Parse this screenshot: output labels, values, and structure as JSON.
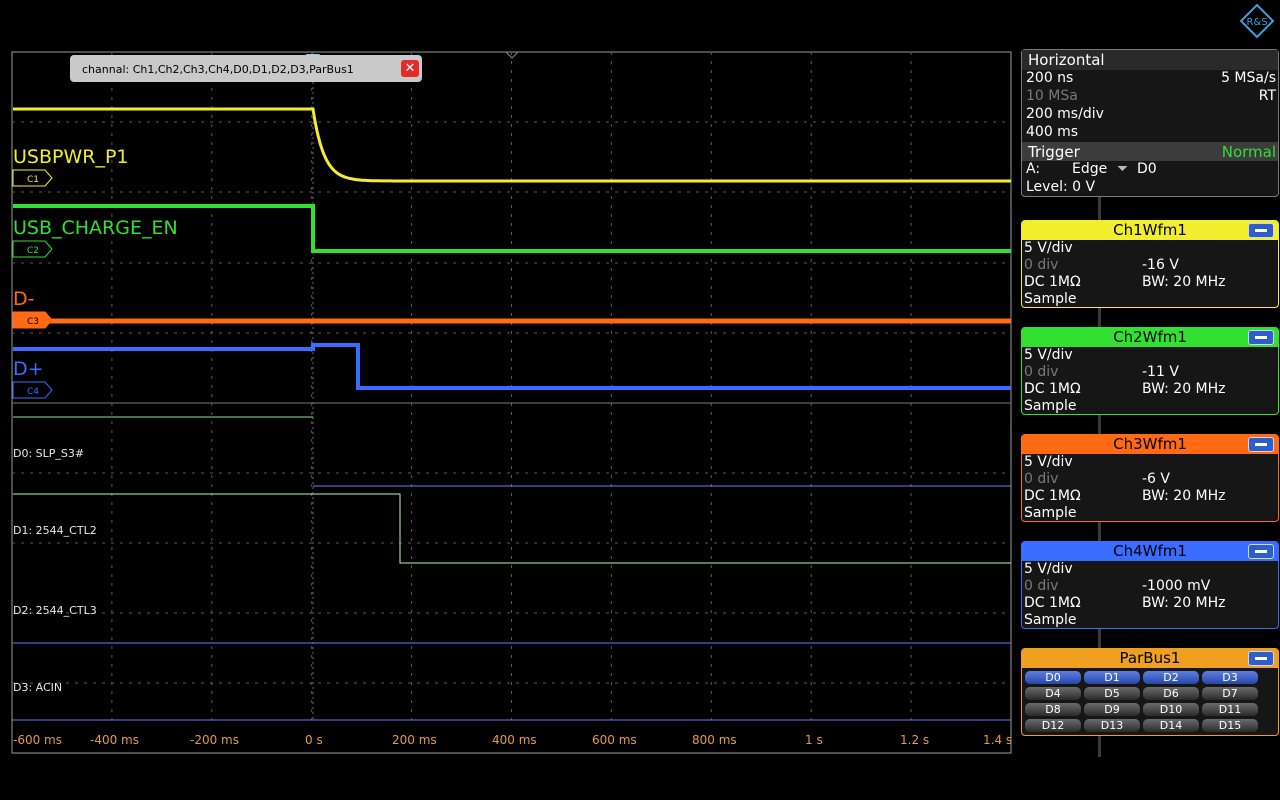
{
  "tab": {
    "label": "channal: Ch1,Ch2,Ch3,Ch4,D0,D1,D2,D3,ParBus1",
    "close_glyph": "✕"
  },
  "channel_labels": {
    "ch1": "USBPWR_P1",
    "ch2": "USB_CHARGE_EN",
    "ch3": "D-",
    "ch4": "D+"
  },
  "channel_markers": [
    "C1",
    "C2",
    "C3",
    "C4"
  ],
  "digital_labels": [
    "D0: SLP_S3#",
    "D1: 2544_CTL2",
    "D2: 2544_CTL3",
    "D3: ACIN"
  ],
  "time_ticks": [
    "-600 ms",
    "-400 ms",
    "-200 ms",
    "0 s",
    "200 ms",
    "400 ms",
    "600 ms",
    "800 ms",
    "1 s",
    "1.2 s",
    "1.4 s"
  ],
  "horizontal": {
    "title": "Horizontal",
    "resolution": "200 ns",
    "sample_rate": "5 MSa/s",
    "record_length": "10 MSa",
    "mode": "RT",
    "time_scale": "200 ms/div",
    "acq_time": "400 ms"
  },
  "trigger": {
    "title": "Trigger",
    "mode": "Normal",
    "source_prefix": "A:",
    "type": "Edge",
    "edge_glyph": "⏷",
    "source": "D0",
    "level": "Level: 0 V"
  },
  "channels": [
    {
      "name": "Ch1Wfm1",
      "color": "#f2ee2e",
      "scale": "5 V/div",
      "position": "0 div",
      "offset": "-16 V",
      "coupling": "DC 1MΩ",
      "bandwidth": "BW: 20 MHz",
      "acq": "Sample"
    },
    {
      "name": "Ch2Wfm1",
      "color": "#32e032",
      "scale": "5 V/div",
      "position": "0 div",
      "offset": "-11 V",
      "coupling": "DC 1MΩ",
      "bandwidth": "BW: 20 MHz",
      "acq": "Sample"
    },
    {
      "name": "Ch3Wfm1",
      "color": "#ff6a13",
      "scale": "5 V/div",
      "position": "0 div",
      "offset": "-6 V",
      "coupling": "DC 1MΩ",
      "bandwidth": "BW: 20 MHz",
      "acq": "Sample"
    },
    {
      "name": "Ch4Wfm1",
      "color": "#3a6dff",
      "scale": "5 V/div",
      "position": "0 div",
      "offset": "-1000 mV",
      "coupling": "DC 1MΩ",
      "bandwidth": "BW: 20 MHz",
      "acq": "Sample"
    }
  ],
  "parbus": {
    "name": "ParBus1",
    "color": "#f0a020",
    "bits": [
      "D0",
      "D1",
      "D2",
      "D3",
      "D4",
      "D5",
      "D6",
      "D7",
      "D8",
      "D9",
      "D10",
      "D11",
      "D12",
      "D13",
      "D14",
      "D15"
    ],
    "active_bits": [
      "D0",
      "D1",
      "D2",
      "D3"
    ]
  },
  "colors": {
    "ch1": "#f2ee2e",
    "ch2": "#32e032",
    "ch3": "#ff6a13",
    "ch4": "#3a6dff",
    "d0": "#8fe08f",
    "d1": "#c8ffc8",
    "d1_high": "#7b88ff",
    "digital": "#6b7bff",
    "tick": "#e19a4a"
  },
  "logo": {
    "text": "R&S"
  }
}
